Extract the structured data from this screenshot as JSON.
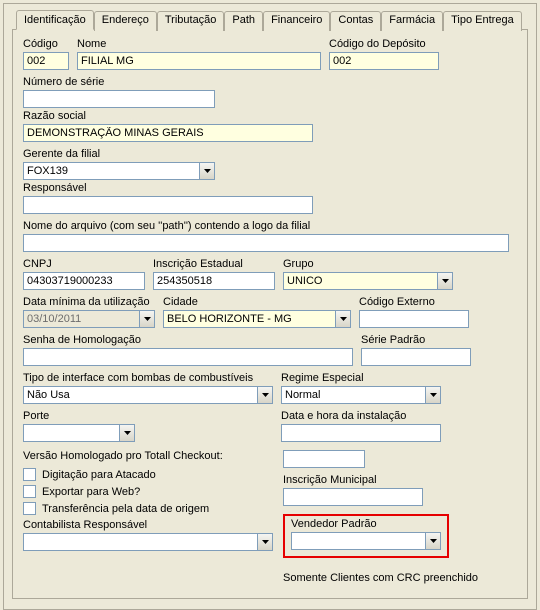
{
  "tabs": {
    "t0": "Identificação",
    "t1": "Endereço",
    "t2": "Tributação",
    "t3": "Path",
    "t4": "Financeiro",
    "t5": "Contas",
    "t6": "Farmácia",
    "t7": "Tipo Entrega"
  },
  "labels": {
    "codigo": "Código",
    "nome": "Nome",
    "codigo_deposito": "Código do Depósito",
    "numero_serie": "Número de série",
    "razao_social": "Razão social",
    "gerente_filial": "Gerente da filial",
    "responsavel": "Responsável",
    "nome_arquivo": "Nome do arquivo (com seu ''path'') contendo a logo da filial",
    "cnpj": "CNPJ",
    "inscricao_estadual": "Inscrição Estadual",
    "grupo": "Grupo",
    "data_minima": "Data mínima da utilização",
    "cidade": "Cidade",
    "codigo_externo": "Código Externo",
    "senha_homolog": "Senha de Homologação",
    "serie_padrao": "Série Padrão",
    "tipo_interface": "Tipo de interface com bombas de combustíveis",
    "regime_especial": "Regime Especial",
    "porte": "Porte",
    "data_hora_instalacao": "Data e hora da instalação",
    "versao_homolog": "Versão Homologado pro Totall Checkout:",
    "digitacao_atacado": "Digitação para Atacado",
    "exportar_web": "Exportar para Web?",
    "transferencia_data": "Transferência pela data de origem",
    "contabilista": "Contabilista Responsável",
    "inscricao_municipal": "Inscrição Municipal",
    "vendedor_padrao": "Vendedor Padrão",
    "somente_clientes": "Somente Clientes com  CRC preenchido"
  },
  "values": {
    "codigo": "002",
    "nome": "FILIAL MG",
    "codigo_deposito": "002",
    "numero_serie": "",
    "razao_social": "DEMONSTRAÇÃO MINAS GERAIS",
    "gerente_filial": "FOX139",
    "responsavel": "",
    "nome_arquivo": "",
    "cnpj": "04303719000233",
    "inscricao_estadual": "254350518",
    "grupo": "UNICO",
    "data_minima": "03/10/2011",
    "cidade": "BELO HORIZONTE - MG",
    "codigo_externo": "",
    "senha_homolog": "",
    "serie_padrao": "",
    "tipo_interface": "Não Usa",
    "regime_especial": "Normal",
    "porte": "",
    "data_hora_instalacao": "",
    "versao_homolog": "",
    "inscricao_municipal": "",
    "vendedor_padrao": "",
    "contabilista": ""
  }
}
